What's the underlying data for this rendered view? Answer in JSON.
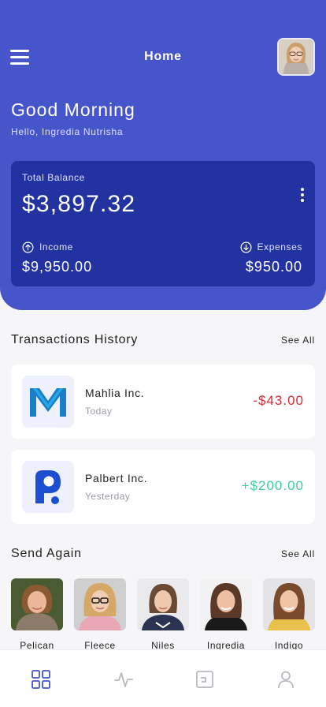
{
  "header": {
    "title": "Home",
    "greeting": "Good Morning",
    "subgreeting": "Hello, Ingredia Nutrisha",
    "icons": {
      "menu": "hamburger-menu-icon",
      "profile": "user-avatar"
    }
  },
  "balance": {
    "label": "Total Balance",
    "amount": "$3,897.32",
    "income_label": "Income",
    "income_value": "$9,950.00",
    "expenses_label": "Expenses",
    "expenses_value": "$950.00"
  },
  "transactions": {
    "title": "Transactions History",
    "see_all": "See All",
    "items": [
      {
        "name": "Mahlia Inc.",
        "date": "Today",
        "amount": "-$43.00",
        "type": "debit"
      },
      {
        "name": "Palbert Inc.",
        "date": "Yesterday",
        "amount": "+$200.00",
        "type": "credit"
      }
    ]
  },
  "send_again": {
    "title": "Send Again",
    "see_all": "See All",
    "contacts": [
      {
        "name": "Pelican"
      },
      {
        "name": "Fleece"
      },
      {
        "name": "Niles"
      },
      {
        "name": "Ingredia"
      },
      {
        "name": "Indigo"
      }
    ]
  },
  "bottom_nav": {
    "items": [
      {
        "icon": "grid-icon",
        "active": true
      },
      {
        "icon": "activity-icon",
        "active": false
      },
      {
        "icon": "card-icon",
        "active": false
      },
      {
        "icon": "user-icon",
        "active": false
      }
    ]
  },
  "colors": {
    "primary": "#4655c9",
    "card": "#2233a1",
    "negative": "#d32b38",
    "positive": "#3ecb9a"
  }
}
